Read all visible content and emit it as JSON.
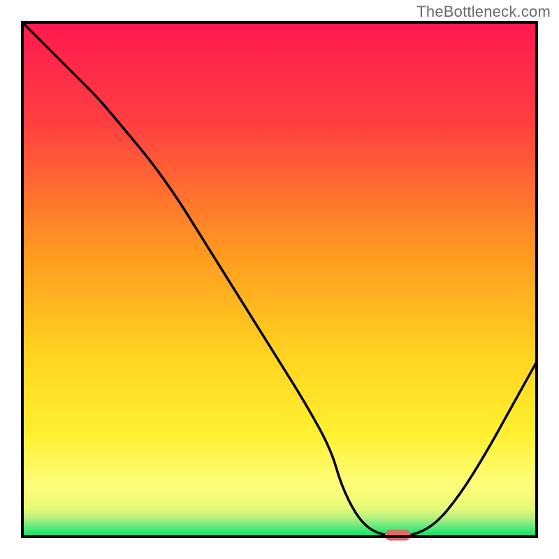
{
  "watermark": "TheBottleneck.com",
  "chart_data": {
    "type": "line",
    "title": "",
    "xlabel": "",
    "ylabel": "",
    "xlim": [
      0,
      100
    ],
    "ylim": [
      0,
      100
    ],
    "x": [
      0,
      5,
      10,
      15,
      20,
      25,
      30,
      35,
      40,
      45,
      50,
      55,
      60,
      62,
      65,
      68,
      72,
      75,
      80,
      85,
      90,
      95,
      100
    ],
    "values": [
      100,
      95,
      90,
      85,
      79,
      73,
      66,
      58,
      50,
      42,
      34,
      26,
      17,
      10,
      4,
      1,
      0,
      0,
      2,
      8,
      16,
      25,
      34
    ],
    "minimum_marker": {
      "x": 73,
      "y": 0
    },
    "background": {
      "type": "gradient",
      "stops": [
        {
          "pos": 0.0,
          "color": "#ff1950"
        },
        {
          "pos": 0.2,
          "color": "#ff4040"
        },
        {
          "pos": 0.45,
          "color": "#ff9a20"
        },
        {
          "pos": 0.65,
          "color": "#ffd420"
        },
        {
          "pos": 0.8,
          "color": "#fff030"
        },
        {
          "pos": 0.9,
          "color": "#fdfd7a"
        },
        {
          "pos": 0.945,
          "color": "#e8f978"
        },
        {
          "pos": 0.965,
          "color": "#aef080"
        },
        {
          "pos": 0.985,
          "color": "#4ce978"
        },
        {
          "pos": 1.0,
          "color": "#00e070"
        }
      ]
    },
    "colors": {
      "frame": "#000000",
      "curve": "#000000",
      "marker_fill": "#e46a6a",
      "marker_stroke": "#d85a5a"
    }
  }
}
